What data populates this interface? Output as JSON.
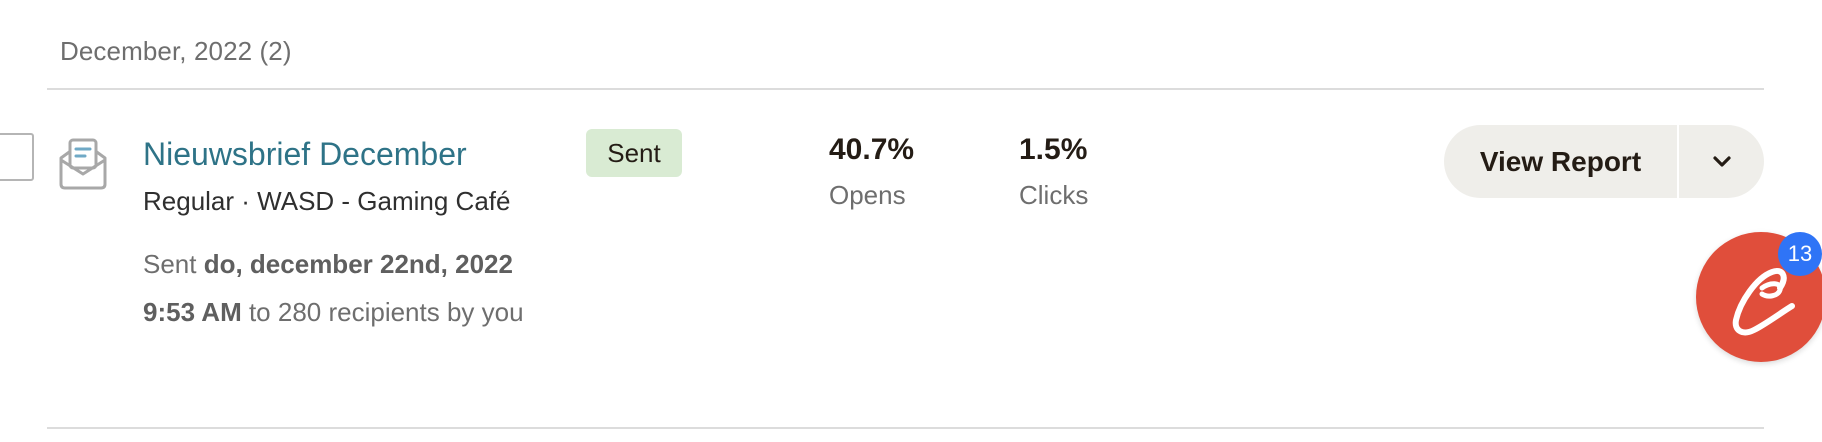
{
  "group": {
    "header": "December, 2022 (2)"
  },
  "campaign": {
    "title": "Nieuwsbrief December",
    "meta": "Regular · WASD - Gaming Café",
    "sent_prefix": "Sent ",
    "sent_date": "do, december 22nd, 2022",
    "sent_time": "9:53 AM",
    "sent_suffix": " to 280 recipients by you",
    "status": "Sent",
    "icon": "envelope-open-icon"
  },
  "stats": {
    "opens_value": "40.7%",
    "opens_label": "Opens",
    "clicks_value": "1.5%",
    "clicks_label": "Clicks"
  },
  "actions": {
    "view_report_label": "View Report",
    "dropdown_icon": "chevron-down-icon"
  },
  "chat": {
    "icon": "chat-bubble-icon",
    "badge_count": "13"
  },
  "colors": {
    "link": "#2e7387",
    "badge_bg": "#d9ebd3",
    "button_bg": "#efeeea",
    "chat_bg": "#e04e3b",
    "notification_bg": "#2f74f6"
  }
}
